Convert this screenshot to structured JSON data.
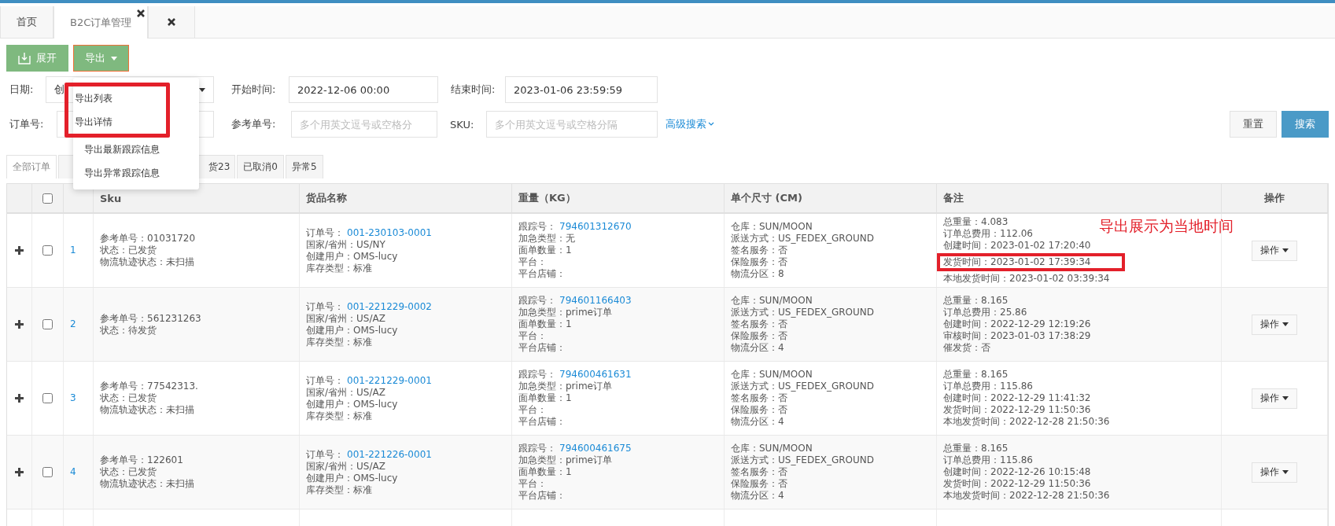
{
  "page_tabs": [
    {
      "label": "首页",
      "selected": false,
      "closable": false
    },
    {
      "label": "B2C订单管理",
      "selected": true,
      "closable": true
    },
    {
      "selected": false,
      "closable": true
    }
  ],
  "toolbar": {
    "expand_button": "展开",
    "export_button": "导出"
  },
  "export_menu": [
    {
      "label": "导出列表",
      "annotated": true
    },
    {
      "label": "导出详情",
      "annotated": true
    },
    {
      "label": "导出最新跟踪信息",
      "annotated": false
    },
    {
      "label": "导出异常跟踪信息",
      "annotated": false
    }
  ],
  "filters": {
    "date_label": "日期:",
    "date_select": "创",
    "start_label": "开始时间:",
    "start_value": "2022-12-06 00:00",
    "end_label": "结束时间:",
    "end_value": "2023-01-06 23:59:59",
    "order_label": "订单号:",
    "ref_label": "参考单号:",
    "ref_placeholder": "多个用英文逗号或空格分",
    "sku_label": "SKU:",
    "sku_placeholder": "多个用英文逗号或空格分隔",
    "advanced_link": "高级搜索",
    "reset_button": "重置",
    "search_button": "搜索"
  },
  "status_tabs": [
    {
      "label": "全部订单",
      "selected": true,
      "kind": "normal"
    },
    {
      "kind": "covered"
    },
    {
      "label": "货23",
      "selected": false,
      "kind": "cut-start"
    },
    {
      "label": "已取消0",
      "selected": false,
      "kind": "normal"
    },
    {
      "label": "异常5",
      "selected": false,
      "kind": "normal"
    }
  ],
  "table": {
    "header_checked": false,
    "columns": [
      "Sku",
      "货品名称",
      "重量（KG）",
      "单个尺寸 (CM)",
      "备注",
      "操作"
    ],
    "rows": [
      {
        "index": "1",
        "checked": false,
        "action": "操作",
        "sku": [
          {
            "label": "参考单号：",
            "value": "01031720",
            "link": false
          },
          {
            "label": "状态：",
            "value": "已发货",
            "link": false
          },
          {
            "label": "物流轨迹状态：",
            "value": "未扫描",
            "link": false
          }
        ],
        "goods": [
          {
            "label": "订单号：",
            "value": "001-230103-0001",
            "link": true
          },
          {
            "label": "国家/省州：",
            "value": "US/NY",
            "link": false
          },
          {
            "label": "创建用户：",
            "value": "OMS-lucy",
            "link": false
          },
          {
            "label": "库存类型：",
            "value": "标准",
            "link": false
          }
        ],
        "weight": [
          {
            "label": "跟踪号：",
            "value": "794601312670",
            "link": true
          },
          {
            "label": "加急类型：",
            "value": "无",
            "link": false
          },
          {
            "label": "面单数量：",
            "value": "1",
            "link": false
          },
          {
            "label": "平台：",
            "link": false
          },
          {
            "label": "平台店铺：",
            "link": false
          }
        ],
        "size": [
          {
            "label": "仓库：",
            "value": "SUN/MOON",
            "link": false
          },
          {
            "label": "派送方式：",
            "value": "US_FEDEX_GROUND",
            "link": false
          },
          {
            "label": "签名服务：",
            "value": "否",
            "link": false
          },
          {
            "label": "保险服务：",
            "value": "否",
            "link": false
          },
          {
            "label": "物流分区：",
            "value": "8",
            "link": false
          }
        ],
        "notes": [
          {
            "text": "总重量：4.083",
            "annotated": false
          },
          {
            "text": "订单总费用：112.06",
            "annotated": false
          },
          {
            "text": "创建时间：2023-01-02 17:20:40",
            "annotated": false
          },
          {
            "text": "发货时间：2023-01-02 17:39:34",
            "annotated": true
          },
          {
            "text": "本地发货时间：2023-01-02 03:39:34",
            "annotated": false
          }
        ],
        "callout": "导出展示为当地时间"
      },
      {
        "index": "2",
        "checked": false,
        "action": "操作",
        "sku": [
          {
            "label": "参考单号：",
            "value": "561231263",
            "link": false
          },
          {
            "label": "状态：",
            "value": "待发货",
            "link": false
          }
        ],
        "goods": [
          {
            "label": "订单号：",
            "value": "001-221229-0002",
            "link": true
          },
          {
            "label": "国家/省州：",
            "value": "US/AZ",
            "link": false
          },
          {
            "label": "创建用户：",
            "value": "OMS-lucy",
            "link": false
          },
          {
            "label": "库存类型：",
            "value": "标准",
            "link": false
          }
        ],
        "weight": [
          {
            "label": "跟踪号：",
            "value": "794601166403",
            "link": true
          },
          {
            "label": "加急类型：",
            "value": "prime订单",
            "link": false
          },
          {
            "label": "面单数量：",
            "value": "1",
            "link": false
          },
          {
            "label": "平台：",
            "link": false
          },
          {
            "label": "平台店铺：",
            "link": false
          }
        ],
        "size": [
          {
            "label": "仓库：",
            "value": "SUN/MOON",
            "link": false
          },
          {
            "label": "派送方式：",
            "value": "US_FEDEX_GROUND",
            "link": false
          },
          {
            "label": "签名服务：",
            "value": "否",
            "link": false
          },
          {
            "label": "保险服务：",
            "value": "否",
            "link": false
          },
          {
            "label": "物流分区：",
            "value": "4",
            "link": false
          }
        ],
        "notes": [
          {
            "text": "总重量：8.165",
            "annotated": false
          },
          {
            "text": "订单总费用：25.86",
            "annotated": false
          },
          {
            "text": "创建时间：2022-12-29 12:19:26",
            "annotated": false
          },
          {
            "text": "审核时间：2023-01-03 17:38:29",
            "annotated": false
          },
          {
            "text": "催发货：否",
            "annotated": false
          }
        ]
      },
      {
        "index": "3",
        "checked": false,
        "action": "操作",
        "sku": [
          {
            "label": "参考单号：",
            "value": "77542313.",
            "link": false
          },
          {
            "label": "状态：",
            "value": "已发货",
            "link": false
          },
          {
            "label": "物流轨迹状态：",
            "value": "未扫描",
            "link": false
          }
        ],
        "goods": [
          {
            "label": "订单号：",
            "value": "001-221229-0001",
            "link": true
          },
          {
            "label": "国家/省州：",
            "value": "US/AZ",
            "link": false
          },
          {
            "label": "创建用户：",
            "value": "OMS-lucy",
            "link": false
          },
          {
            "label": "库存类型：",
            "value": "标准",
            "link": false
          }
        ],
        "weight": [
          {
            "label": "跟踪号：",
            "value": "794600461631",
            "link": true
          },
          {
            "label": "加急类型：",
            "value": "prime订单",
            "link": false
          },
          {
            "label": "面单数量：",
            "value": "1",
            "link": false
          },
          {
            "label": "平台：",
            "link": false
          },
          {
            "label": "平台店铺：",
            "link": false
          }
        ],
        "size": [
          {
            "label": "仓库：",
            "value": "SUN/MOON",
            "link": false
          },
          {
            "label": "派送方式：",
            "value": "US_FEDEX_GROUND",
            "link": false
          },
          {
            "label": "签名服务：",
            "value": "否",
            "link": false
          },
          {
            "label": "保险服务：",
            "value": "否",
            "link": false
          },
          {
            "label": "物流分区：",
            "value": "4",
            "link": false
          }
        ],
        "notes": [
          {
            "text": "总重量：8.165",
            "annotated": false
          },
          {
            "text": "订单总费用：115.86",
            "annotated": false
          },
          {
            "text": "创建时间：2022-12-29 11:41:32",
            "annotated": false
          },
          {
            "text": "发货时间：2022-12-29 11:50:36",
            "annotated": false
          },
          {
            "text": "本地发货时间：2022-12-28 21:50:36",
            "annotated": false
          }
        ]
      },
      {
        "index": "4",
        "checked": false,
        "action": "操作",
        "sku": [
          {
            "label": "参考单号：",
            "value": "122601",
            "link": false
          },
          {
            "label": "状态：",
            "value": "已发货",
            "link": false
          },
          {
            "label": "物流轨迹状态：",
            "value": "未扫描",
            "link": false
          }
        ],
        "goods": [
          {
            "label": "订单号：",
            "value": "001-221226-0001",
            "link": true
          },
          {
            "label": "国家/省州：",
            "value": "US/AZ",
            "link": false
          },
          {
            "label": "创建用户：",
            "value": "OMS-lucy",
            "link": false
          },
          {
            "label": "库存类型：",
            "value": "标准",
            "link": false
          }
        ],
        "weight": [
          {
            "label": "跟踪号：",
            "value": "794600461675",
            "link": true
          },
          {
            "label": "加急类型：",
            "value": "prime订单",
            "link": false
          },
          {
            "label": "面单数量：",
            "value": "1",
            "link": false
          },
          {
            "label": "平台：",
            "link": false
          },
          {
            "label": "平台店铺：",
            "link": false
          }
        ],
        "size": [
          {
            "label": "仓库：",
            "value": "SUN/MOON",
            "link": false
          },
          {
            "label": "派送方式：",
            "value": "US_FEDEX_GROUND",
            "link": false
          },
          {
            "label": "签名服务：",
            "value": "否",
            "link": false
          },
          {
            "label": "保险服务：",
            "value": "否",
            "link": false
          },
          {
            "label": "物流分区：",
            "value": "4",
            "link": false
          }
        ],
        "notes": [
          {
            "text": "总重量：8.165",
            "annotated": false
          },
          {
            "text": "订单总费用：115.86",
            "annotated": false
          },
          {
            "text": "创建时间：2022-12-26 10:15:48",
            "annotated": false
          },
          {
            "text": "发货时间：2022-12-29 11:50:36",
            "annotated": false
          },
          {
            "text": "本地发货时间：2022-12-28 21:50:36",
            "annotated": false
          }
        ]
      }
    ]
  }
}
